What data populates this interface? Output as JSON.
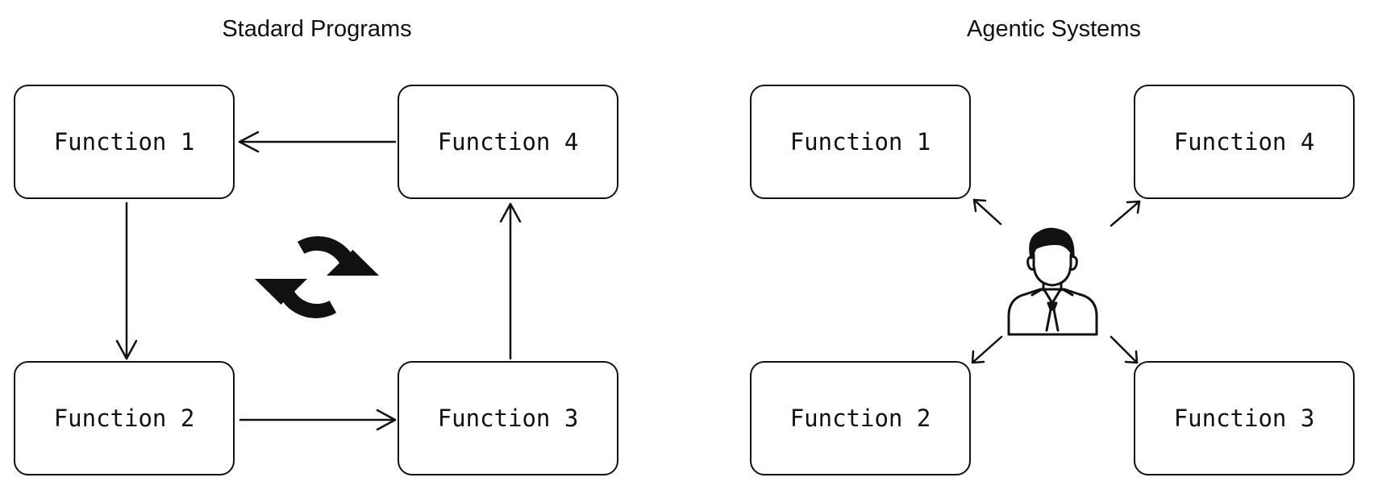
{
  "left": {
    "title": "Stadard Programs",
    "functions": {
      "f1": "Function 1",
      "f2": "Function 2",
      "f3": "Function 3",
      "f4": "Function 4"
    }
  },
  "right": {
    "title": "Agentic Systems",
    "functions": {
      "f1": "Function 1",
      "f2": "Function 2",
      "f3": "Function 3",
      "f4": "Function 4"
    }
  },
  "icons": {
    "cycle": "refresh-cycle-icon",
    "agent": "businessman-icon"
  },
  "colors": {
    "stroke": "#111111",
    "background": "#ffffff"
  }
}
